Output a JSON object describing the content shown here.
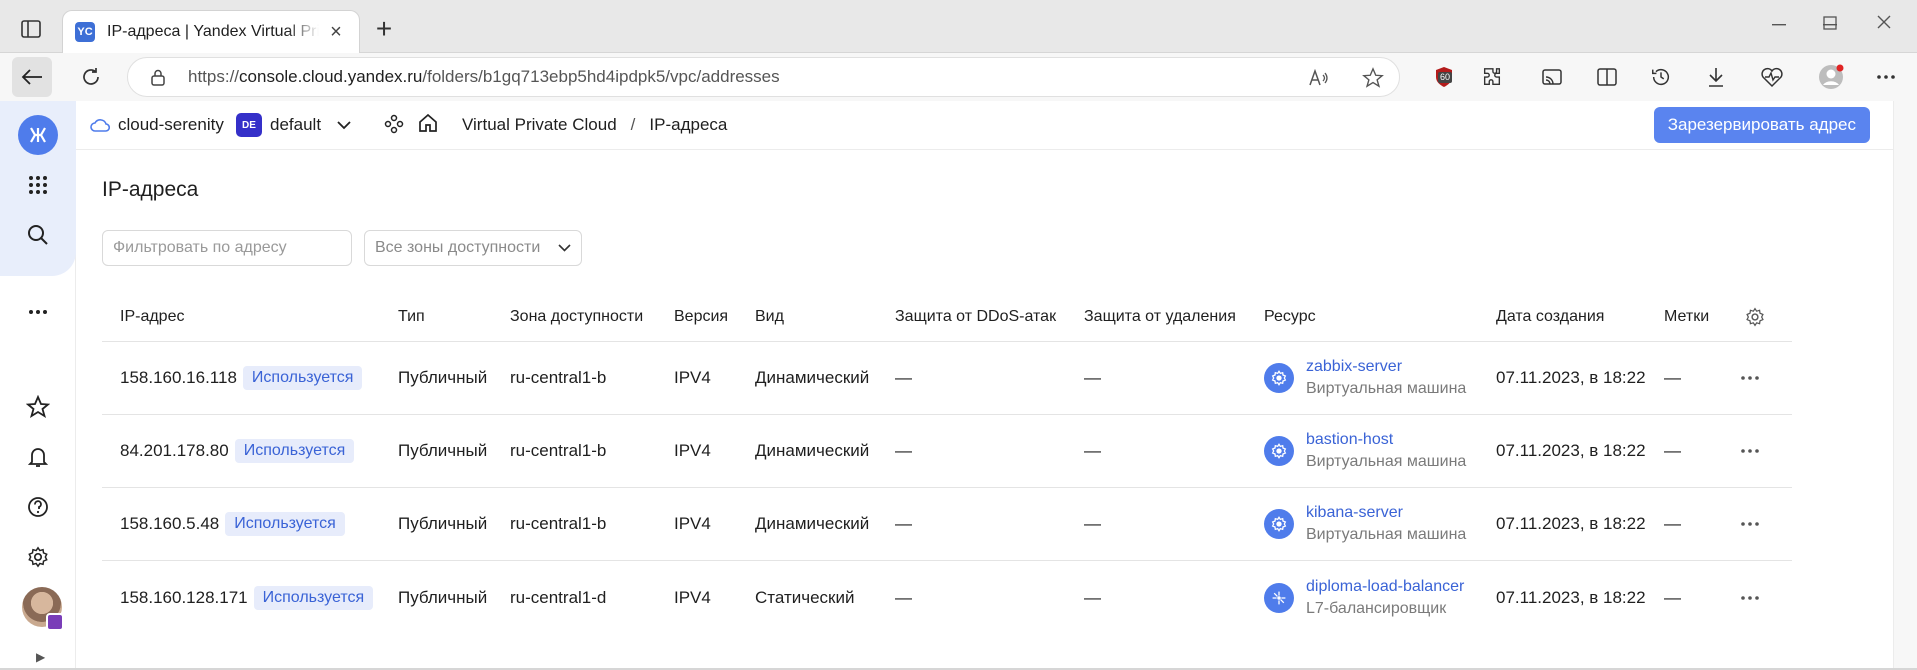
{
  "browser": {
    "tab_favicon": "YC",
    "tab_title": "IP-адреса | Yandex Virtual Private Cloud",
    "url_scheme": "https://",
    "url_host": "console.cloud.yandex.ru",
    "url_path": "/folders/b1gq713ebp5hd4ipdpk5/vpc/addresses",
    "extension_badge": "60"
  },
  "header": {
    "cloud_name": "cloud-serenity",
    "folder_badge": "DE",
    "folder_name": "default",
    "service": "Virtual Private Cloud",
    "separator": "/",
    "current_page": "IP-адреса",
    "reserve_button": "Зарезервировать адрес"
  },
  "page": {
    "title": "IP-адреса",
    "filter_placeholder": "Фильтровать по адресу",
    "zones_select": "Все зоны доступности"
  },
  "table": {
    "columns": [
      "IP-адрес",
      "Тип",
      "Зона доступности",
      "Версия",
      "Вид",
      "Защита от DDoS-атак",
      "Защита от удаления",
      "Ресурс",
      "Дата создания",
      "Метки"
    ],
    "rows": [
      {
        "ip": "158.160.16.118",
        "status": "Используется",
        "type": "Публичный",
        "zone": "ru-central1-b",
        "version": "IPV4",
        "kind": "Динамический",
        "ddos": "—",
        "deletion": "—",
        "resource_name": "zabbix-server",
        "resource_type": "Виртуальная машина",
        "resource_icon": "vm-icon",
        "created": "07.11.2023, в 18:22",
        "labels": "—"
      },
      {
        "ip": "84.201.178.80",
        "status": "Используется",
        "type": "Публичный",
        "zone": "ru-central1-b",
        "version": "IPV4",
        "kind": "Динамический",
        "ddos": "—",
        "deletion": "—",
        "resource_name": "bastion-host",
        "resource_type": "Виртуальная машина",
        "resource_icon": "vm-icon",
        "created": "07.11.2023, в 18:22",
        "labels": "—"
      },
      {
        "ip": "158.160.5.48",
        "status": "Используется",
        "type": "Публичный",
        "zone": "ru-central1-b",
        "version": "IPV4",
        "kind": "Динамический",
        "ddos": "—",
        "deletion": "—",
        "resource_name": "kibana-server",
        "resource_type": "Виртуальная машина",
        "resource_icon": "vm-icon",
        "created": "07.11.2023, в 18:22",
        "labels": "—"
      },
      {
        "ip": "158.160.128.171",
        "status": "Используется",
        "type": "Публичный",
        "zone": "ru-central1-d",
        "version": "IPV4",
        "kind": "Статический",
        "ddos": "—",
        "deletion": "—",
        "resource_name": "diploma-load-balancer",
        "resource_type": "L7-балансировщик",
        "resource_icon": "load-balancer-icon",
        "created": "07.11.2023, в 18:22",
        "labels": "—"
      }
    ]
  },
  "colors": {
    "accent": "#5a84ef",
    "link": "#3a63d6",
    "chip_bg": "#e7ecfb",
    "folder_badge": "#3530c9"
  }
}
